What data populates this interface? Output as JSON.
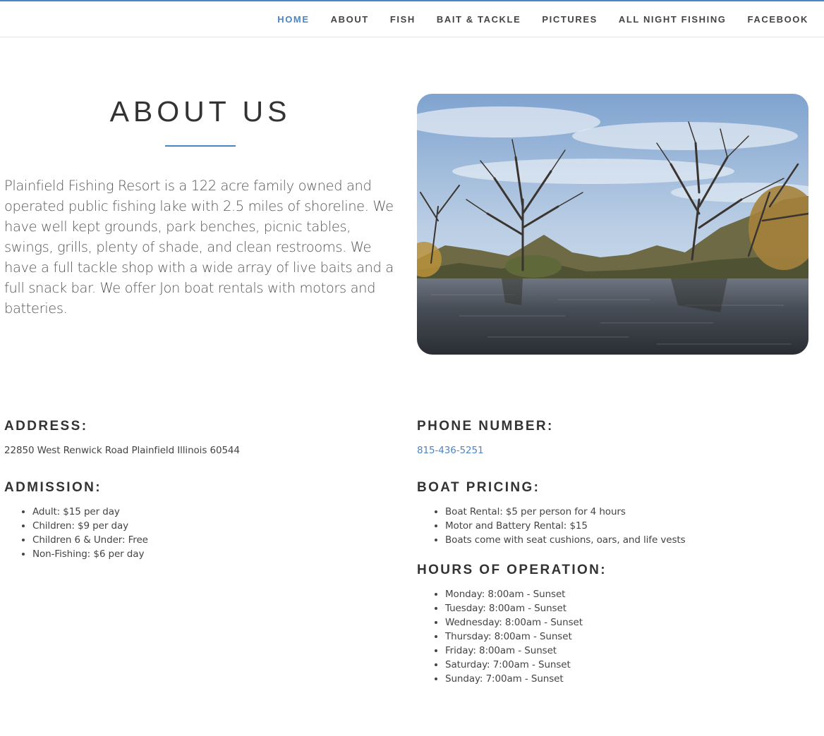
{
  "nav": {
    "items": [
      {
        "label": "HOME",
        "active": true
      },
      {
        "label": "ABOUT",
        "active": false
      },
      {
        "label": "FISH",
        "active": false
      },
      {
        "label": "BAIT & TACKLE",
        "active": false
      },
      {
        "label": "PICTURES",
        "active": false
      },
      {
        "label": "ALL NIGHT FISHING",
        "active": false
      },
      {
        "label": "FACEBOOK",
        "active": false
      }
    ]
  },
  "about": {
    "title": "ABOUT US",
    "body": "Plainfield Fishing Resort is a 122 acre family owned and operated public fishing lake with 2.5 miles of shoreline. We have well kept grounds, park benches, picnic tables, swings, grills, plenty of shade, and clean restrooms. We have a full tackle shop with a wide array of live baits and a full snack bar. We offer Jon boat rentals with motors and batteries."
  },
  "address": {
    "heading": "ADDRESS:",
    "value": "22850 West Renwick Road Plainfield Illinois 60544"
  },
  "phone": {
    "heading": "PHONE NUMBER:",
    "value": "815-436-5251"
  },
  "admission": {
    "heading": "ADMISSION:",
    "items": [
      "Adult: $15 per day",
      "Children: $9 per day",
      "Children 6 & Under: Free",
      "Non-Fishing: $6 per day"
    ]
  },
  "boat_pricing": {
    "heading": "BOAT PRICING:",
    "items": [
      "Boat Rental: $5 per person for 4 hours",
      "Motor and Battery Rental: $15",
      "Boats come with seat cushions, oars, and life vests"
    ]
  },
  "hours": {
    "heading": "HOURS OF OPERATION:",
    "items": [
      "Monday: 8:00am - Sunset",
      "Tuesday: 8:00am - Sunset",
      "Wednesday: 8:00am - Sunset",
      "Thursday: 8:00am - Sunset",
      "Friday: 8:00am - Sunset",
      "Saturday: 7:00am - Sunset",
      "Sunday: 7:00am - Sunset"
    ]
  },
  "colors": {
    "accent": "#4a86c5",
    "heading": "#333333",
    "body_text": "#555555"
  },
  "icons": {
    "list_bullet": "disc-bullet-icon"
  }
}
